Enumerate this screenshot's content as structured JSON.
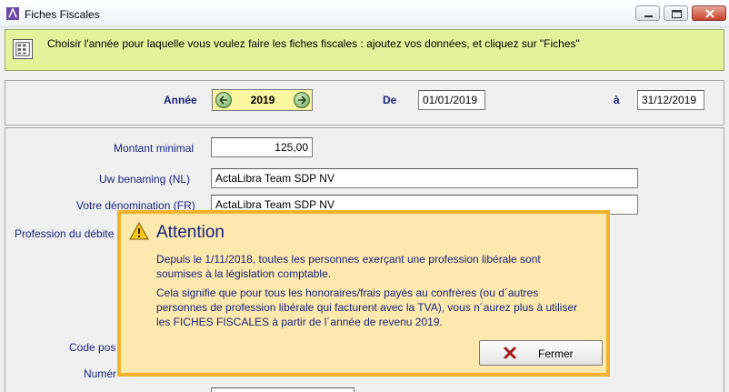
{
  "window": {
    "title": "Fiches Fiscales"
  },
  "banner": {
    "text": "Choisir l'année pour laquelle vous voulez faire les fiches fiscales : ajoutez vos données, et cliquez sur \"Fiches\""
  },
  "period": {
    "year_label": "Année",
    "year_value": "2019",
    "from_label": "De",
    "from_value": "01/01/2019",
    "to_label": "à",
    "to_value": "31/12/2019"
  },
  "form": {
    "min_amount_label": "Montant minimal",
    "min_amount_value": "125,00",
    "name_nl_label": "Uw benaming (NL)",
    "name_nl_value": "ActaLibra Team SDP NV",
    "name_fr_label": "Votre dénomination (FR)",
    "name_fr_value": "ActaLibra Team SDP NV",
    "profession_label": "Profession du débite",
    "postal_code_label": "Code pos",
    "number_label": "Numér"
  },
  "dialog": {
    "title": "Attention",
    "paragraph1": "Depuis le 1/11/2018, toutes les personnes exerçant une profession libérale sont soumises à la législation comptable.",
    "paragraph2": "Cela signifie que pour tous les honoraires/frais payés au confrères (ou d´autres personnes de profession libérale qui facturent avec la TVA), vous n´aurez plus à utiliser les FICHES FISCALES à partir de l´année de revenu 2019.",
    "close_label": "Fermer"
  },
  "colors": {
    "banner_bg": "#e4f29a",
    "dialog_bg": "#fde9ad",
    "dialog_border": "#f2b22e",
    "label_text": "#1a237e",
    "year_bg": "#fbf6a0"
  },
  "icons": {
    "app": "app-icon",
    "warning": "warning-icon",
    "close": "close-x-icon"
  }
}
